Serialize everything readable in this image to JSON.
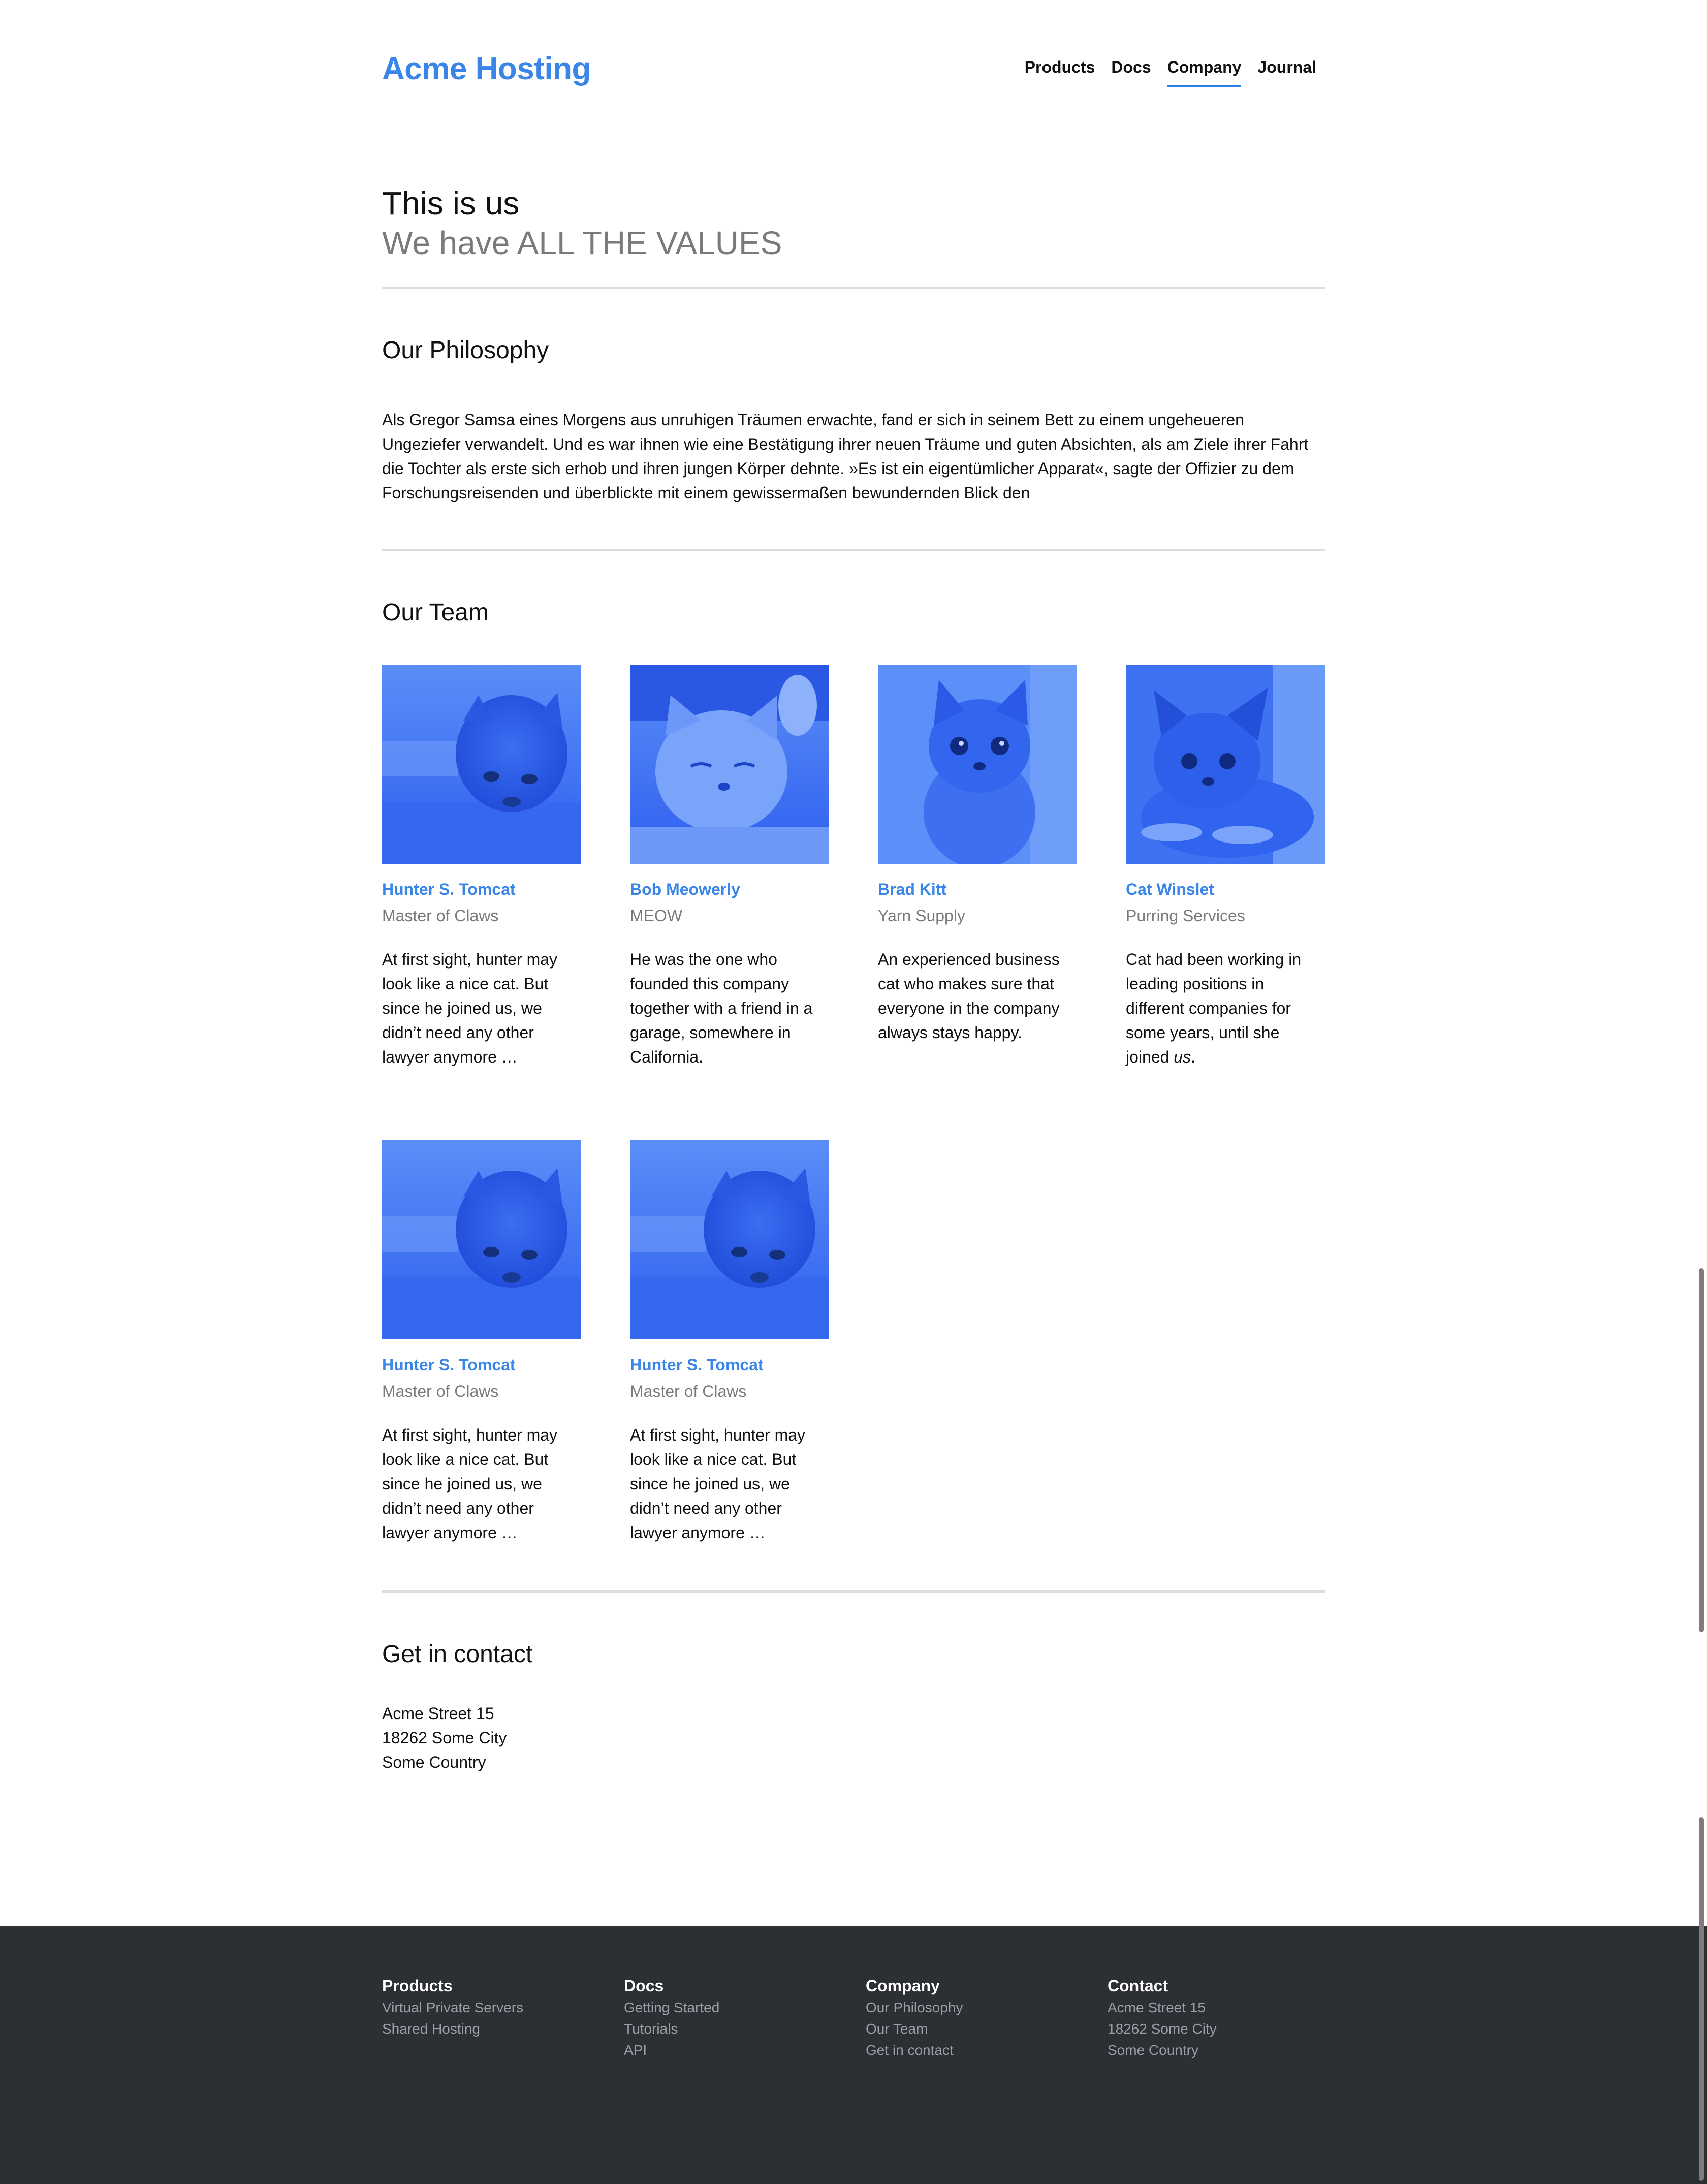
{
  "header": {
    "logo": "Acme Hosting",
    "nav": [
      {
        "label": "Products",
        "active": false
      },
      {
        "label": "Docs",
        "active": false
      },
      {
        "label": "Company",
        "active": true
      },
      {
        "label": "Journal",
        "active": false
      }
    ]
  },
  "hero": {
    "title": "This is us",
    "subtitle": "We have ALL THE VALUES"
  },
  "philosophy": {
    "title": "Our Philosophy",
    "text": "Als Gregor Samsa eines Morgens aus unruhigen Träumen erwachte, fand er sich in seinem Bett zu einem ungeheueren Ungeziefer verwandelt. Und es war ihnen wie eine Bestätigung ihrer neuen Träume und guten Absichten, als am Ziele ihrer Fahrt die Tochter als erste sich erhob und ihren jungen Körper dehnte. »Es ist ein eigentümlicher Apparat«, sagte der Offizier zu dem Forschungsreisenden und überblickte mit einem gewissermaßen bewundernden Blick den"
  },
  "team": {
    "title": "Our Team",
    "members": [
      {
        "name": "Hunter S. Tomcat",
        "role": "Master of Claws",
        "bio": "At first sight, hunter may look like a nice cat. But since he joined us, we didn’t need any other lawyer anymore …",
        "photo": "kitten-sniffing-icon"
      },
      {
        "name": "Bob Meowerly",
        "role": "MEOW",
        "bio": "He was the one who founded this company together with a friend in a garage, somewhere in California.",
        "photo": "kitten-sleepy-icon"
      },
      {
        "name": "Brad Kitt",
        "role": "Yarn Supply",
        "bio": "An experienced business cat who makes sure that everyone in the company always stays happy.",
        "photo": "kitten-sitting-icon"
      },
      {
        "name": "Cat Winslet",
        "role": "Purring Services",
        "bio_before": "Cat had been working in leading positions in different companies for some years, until she joined ",
        "bio_em": "us",
        "bio_after": ".",
        "photo": "kitten-lying-icon"
      },
      {
        "name": "Hunter S. Tomcat",
        "role": "Master of Claws",
        "bio": "At first sight, hunter may look like a nice cat. But since he joined us, we didn’t need any other lawyer anymore …",
        "photo": "kitten-sniffing-icon"
      },
      {
        "name": "Hunter S. Tomcat",
        "role": "Master of Claws",
        "bio": "At first sight, hunter may look like a nice cat. But since he joined us, we didn’t need any other lawyer anymore …",
        "photo": "kitten-sniffing-icon"
      }
    ]
  },
  "contact": {
    "title": "Get in contact",
    "lines": [
      "Acme Street 15",
      "18262 Some City",
      "Some Country"
    ]
  },
  "footer": {
    "columns": [
      {
        "heading": "Products",
        "links": [
          "Virtual Private Servers",
          "Shared Hosting"
        ]
      },
      {
        "heading": "Docs",
        "links": [
          "Getting Started",
          "Tutorials",
          "API"
        ]
      },
      {
        "heading": "Company",
        "links": [
          "Our Philosophy",
          "Our Team",
          "Get in contact"
        ]
      },
      {
        "heading": "Contact",
        "lines": [
          "Acme Street 15",
          "18262 Some City",
          "Some Country"
        ]
      }
    ]
  },
  "colors": {
    "accent": "#3a86e8",
    "photo_tint": "#2f6bff",
    "footer_bg": "#2c2f33"
  }
}
